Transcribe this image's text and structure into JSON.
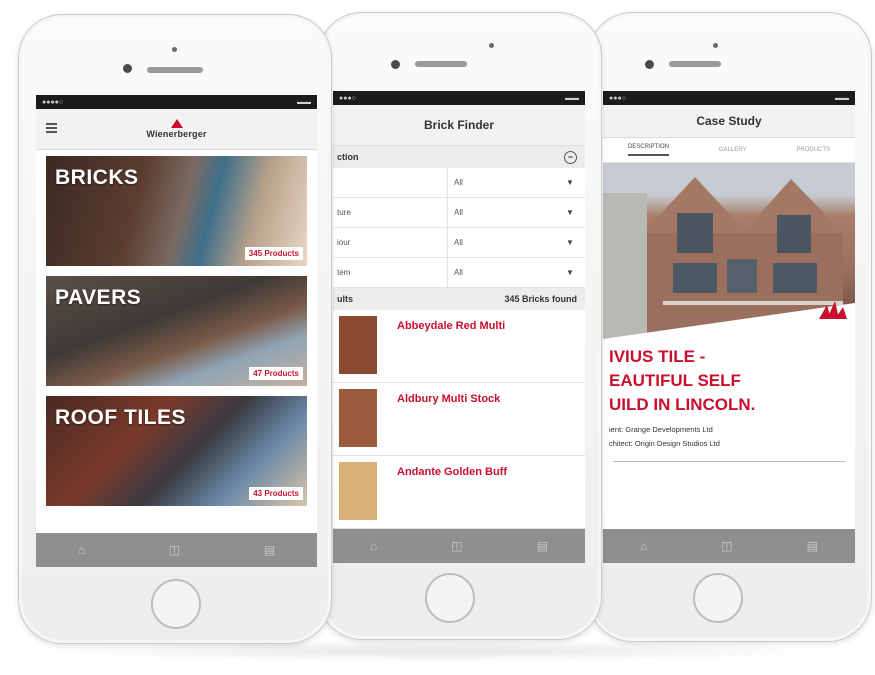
{
  "left_phone": {
    "brand": "Wienerberger",
    "categories": [
      {
        "label": "BRICKS",
        "count": "345 Products"
      },
      {
        "label": "PAVERS",
        "count": "47 Products"
      },
      {
        "label": "ROOF TILES",
        "count": "43 Products"
      }
    ]
  },
  "middle_phone": {
    "title": "Brick Finder",
    "section_label": "ction",
    "filters": [
      {
        "label": "",
        "value": "All"
      },
      {
        "label": "ture",
        "value": "All"
      },
      {
        "label": "iour",
        "value": "All"
      },
      {
        "label": "tem",
        "value": "All"
      }
    ],
    "results_label": "ults",
    "results_count": "345 Bricks found",
    "products": [
      {
        "name": "Abbeydale Red Multi",
        "color": "#8a4a32"
      },
      {
        "name": "Aldbury Multi Stock",
        "color": "#9a5a3c"
      },
      {
        "name": "Andante Golden Buff",
        "color": "#d8b07a"
      }
    ]
  },
  "right_phone": {
    "title": "Case Study",
    "tabs": [
      "DESCRIPTION",
      "GALLERY",
      "PRODUCTS"
    ],
    "headline": [
      "IVIUS TILE -",
      "EAUTIFUL SELF",
      "UILD IN LINCOLN."
    ],
    "client": "ient: Grange Developments Ltd",
    "architect": "chitect: Origin Design Studios Ltd"
  },
  "colors": {
    "brand_red": "#c8102e",
    "tabbar": "#8f8f8f"
  }
}
